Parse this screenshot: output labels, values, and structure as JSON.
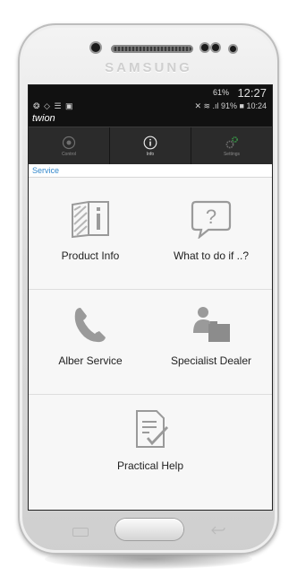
{
  "device": {
    "brand": "SAMSUNG"
  },
  "status_bar": {
    "battery": "61%",
    "time": "12:27"
  },
  "app_status_bar": {
    "left": "❂ ◇ ☰ ▣",
    "right": "✕ ≋ .ıl 91% ■ 10:24"
  },
  "app": {
    "title": "twion"
  },
  "tabs": [
    {
      "label": "Control",
      "icon": "wheel-icon"
    },
    {
      "label": "Info",
      "icon": "info-icon"
    },
    {
      "label": "Settings",
      "icon": "gears-icon"
    }
  ],
  "breadcrumb": "Service",
  "menu": [
    {
      "label": "Product Info",
      "icon": "product-info-icon"
    },
    {
      "label": "What to do if ..?",
      "icon": "question-bubble-icon"
    },
    {
      "label": "Alber Service",
      "icon": "phone-icon"
    },
    {
      "label": "Specialist Dealer",
      "icon": "dealer-icon"
    },
    {
      "label": "Practical Help",
      "icon": "checklist-icon"
    }
  ],
  "colors": {
    "accent": "#3388cc",
    "icon_grey": "#999999",
    "tabbar": "#2b2b2b"
  }
}
